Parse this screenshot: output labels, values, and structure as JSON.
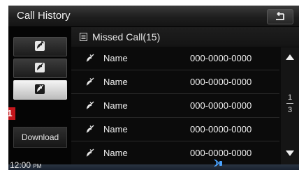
{
  "window": {
    "title": "Call History"
  },
  "header": {
    "label": "Missed Call(15)"
  },
  "sidebar": {
    "buttons": [
      {
        "icon": "outgoing-call-icon"
      },
      {
        "icon": "incoming-call-icon"
      },
      {
        "icon": "missed-call-icon",
        "selected": true
      }
    ],
    "download_label": "Download",
    "callout_number": "1"
  },
  "calls": [
    {
      "name": "Name",
      "number": "000-0000-0000"
    },
    {
      "name": "Name",
      "number": "000-0000-0000"
    },
    {
      "name": "Name",
      "number": "000-0000-0000"
    },
    {
      "name": "Name",
      "number": "000-0000-0000"
    },
    {
      "name": "Name",
      "number": "000-0000-0000"
    }
  ],
  "pagination": {
    "current": "1",
    "total": "3"
  },
  "status": {
    "time": "12:00",
    "ampm": "PM"
  },
  "colors": {
    "callout": "#c4161c",
    "background": "#0b0b0b"
  }
}
